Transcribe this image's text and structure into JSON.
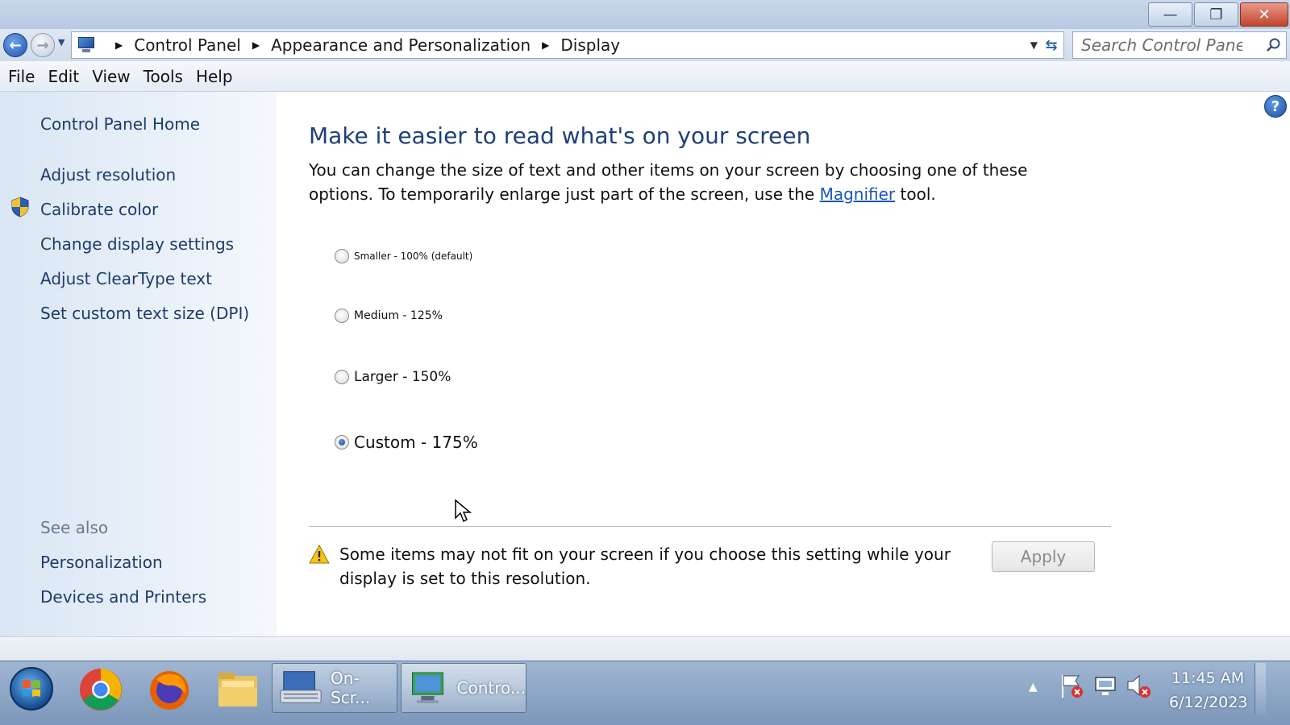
{
  "window": {
    "buttons": {
      "minimize": "—",
      "restore": "❐",
      "close": "✕"
    }
  },
  "address_bar": {
    "breadcrumbs": [
      "Control Panel",
      "Appearance and Personalization",
      "Display"
    ],
    "search_placeholder": "Search Control Panel"
  },
  "menu": [
    "File",
    "Edit",
    "View",
    "Tools",
    "Help"
  ],
  "sidebar": {
    "links": [
      "Control Panel Home",
      "Adjust resolution",
      "Calibrate color",
      "Change display settings",
      "Adjust ClearType text",
      "Set custom text size (DPI)"
    ],
    "see_also_heading": "See also",
    "see_also_links": [
      "Personalization",
      "Devices and Printers"
    ]
  },
  "main": {
    "title": "Make it easier to read what's on your screen",
    "intro_before": "You can change the size of text and other items on your screen by choosing one of these options. To temporarily enlarge just part of the screen, use the",
    "intro_link": "Magnifier",
    "intro_after": "tool.",
    "options": [
      {
        "label": "Smaller - 100% (default)",
        "checked": false
      },
      {
        "label": "Medium - 125%",
        "checked": false
      },
      {
        "label": "Larger - 150%",
        "checked": false
      },
      {
        "label": "Custom - 175%",
        "checked": true
      }
    ],
    "warning": "Some items may not fit on your screen if you choose this setting while your display is set to this resolution.",
    "apply_label": "Apply"
  },
  "taskbar": {
    "tasks": [
      {
        "label": "On-Scr...",
        "active": false
      },
      {
        "label": "Contro...",
        "active": true
      }
    ],
    "clock_time": "11:45 AM",
    "clock_date": "6/12/2023"
  },
  "colors": {
    "title_blue": "#1e3f7a",
    "link_blue": "#1a56b8",
    "sidebar_link": "#1e3c6a"
  }
}
